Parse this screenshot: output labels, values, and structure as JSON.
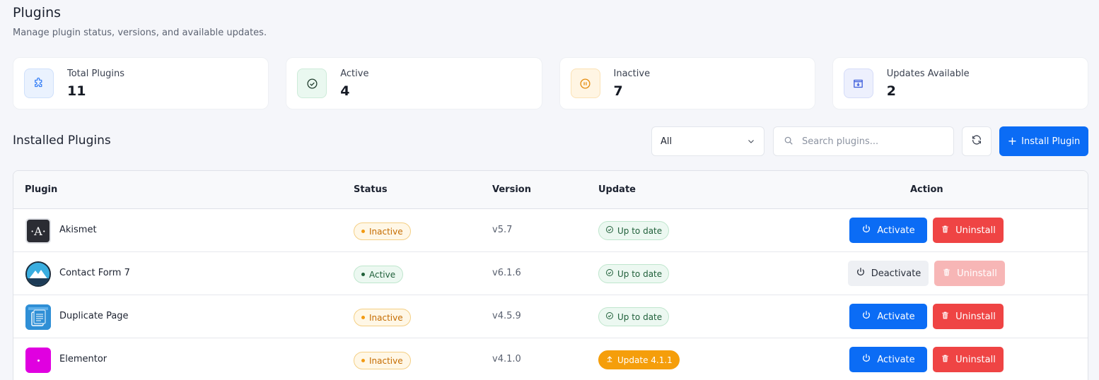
{
  "header": {
    "title": "Plugins",
    "subtitle": "Manage plugin status, versions, and available updates."
  },
  "stats": [
    {
      "label": "Total Plugins",
      "value": "11",
      "icon": "puzzle-icon",
      "color": "#3b82f6",
      "bg": "#eaf2fe"
    },
    {
      "label": "Active",
      "value": "4",
      "icon": "check-circle-icon",
      "color": "#1f6b43",
      "bg": "#eaf8f0"
    },
    {
      "label": "Inactive",
      "value": "7",
      "icon": "pause-circle-icon",
      "color": "#e58a0a",
      "bg": "#fff5e3"
    },
    {
      "label": "Updates Available",
      "value": "2",
      "icon": "download-icon",
      "color": "#3b5bdb",
      "bg": "#edf0fd"
    }
  ],
  "toolbar": {
    "section_title": "Installed Plugins",
    "filter_value": "All",
    "search_placeholder": "Search plugins...",
    "install_label": "Install Plugin"
  },
  "table": {
    "headers": {
      "plugin": "Plugin",
      "status": "Status",
      "version": "Version",
      "update": "Update",
      "action": "Action"
    },
    "rows": [
      {
        "name": "Akismet",
        "status": "Inactive",
        "version": "v5.7",
        "update": "Up to date",
        "action": "Activate",
        "uninstall": "Uninstall"
      },
      {
        "name": "Contact Form 7",
        "status": "Active",
        "version": "v6.1.6",
        "update": "Up to date",
        "action": "Deactivate",
        "uninstall": "Uninstall"
      },
      {
        "name": "Duplicate Page",
        "status": "Inactive",
        "version": "v4.5.9",
        "update": "Up to date",
        "action": "Activate",
        "uninstall": "Uninstall"
      },
      {
        "name": "Elementor",
        "status": "Inactive",
        "version": "v4.1.0",
        "update": "Update 4.1.1",
        "action": "Activate",
        "uninstall": "Uninstall"
      }
    ]
  },
  "colors": {
    "primary": "#0b6cf5",
    "danger": "#ef4444",
    "warning": "#f59e0b",
    "success": "#20603a"
  }
}
